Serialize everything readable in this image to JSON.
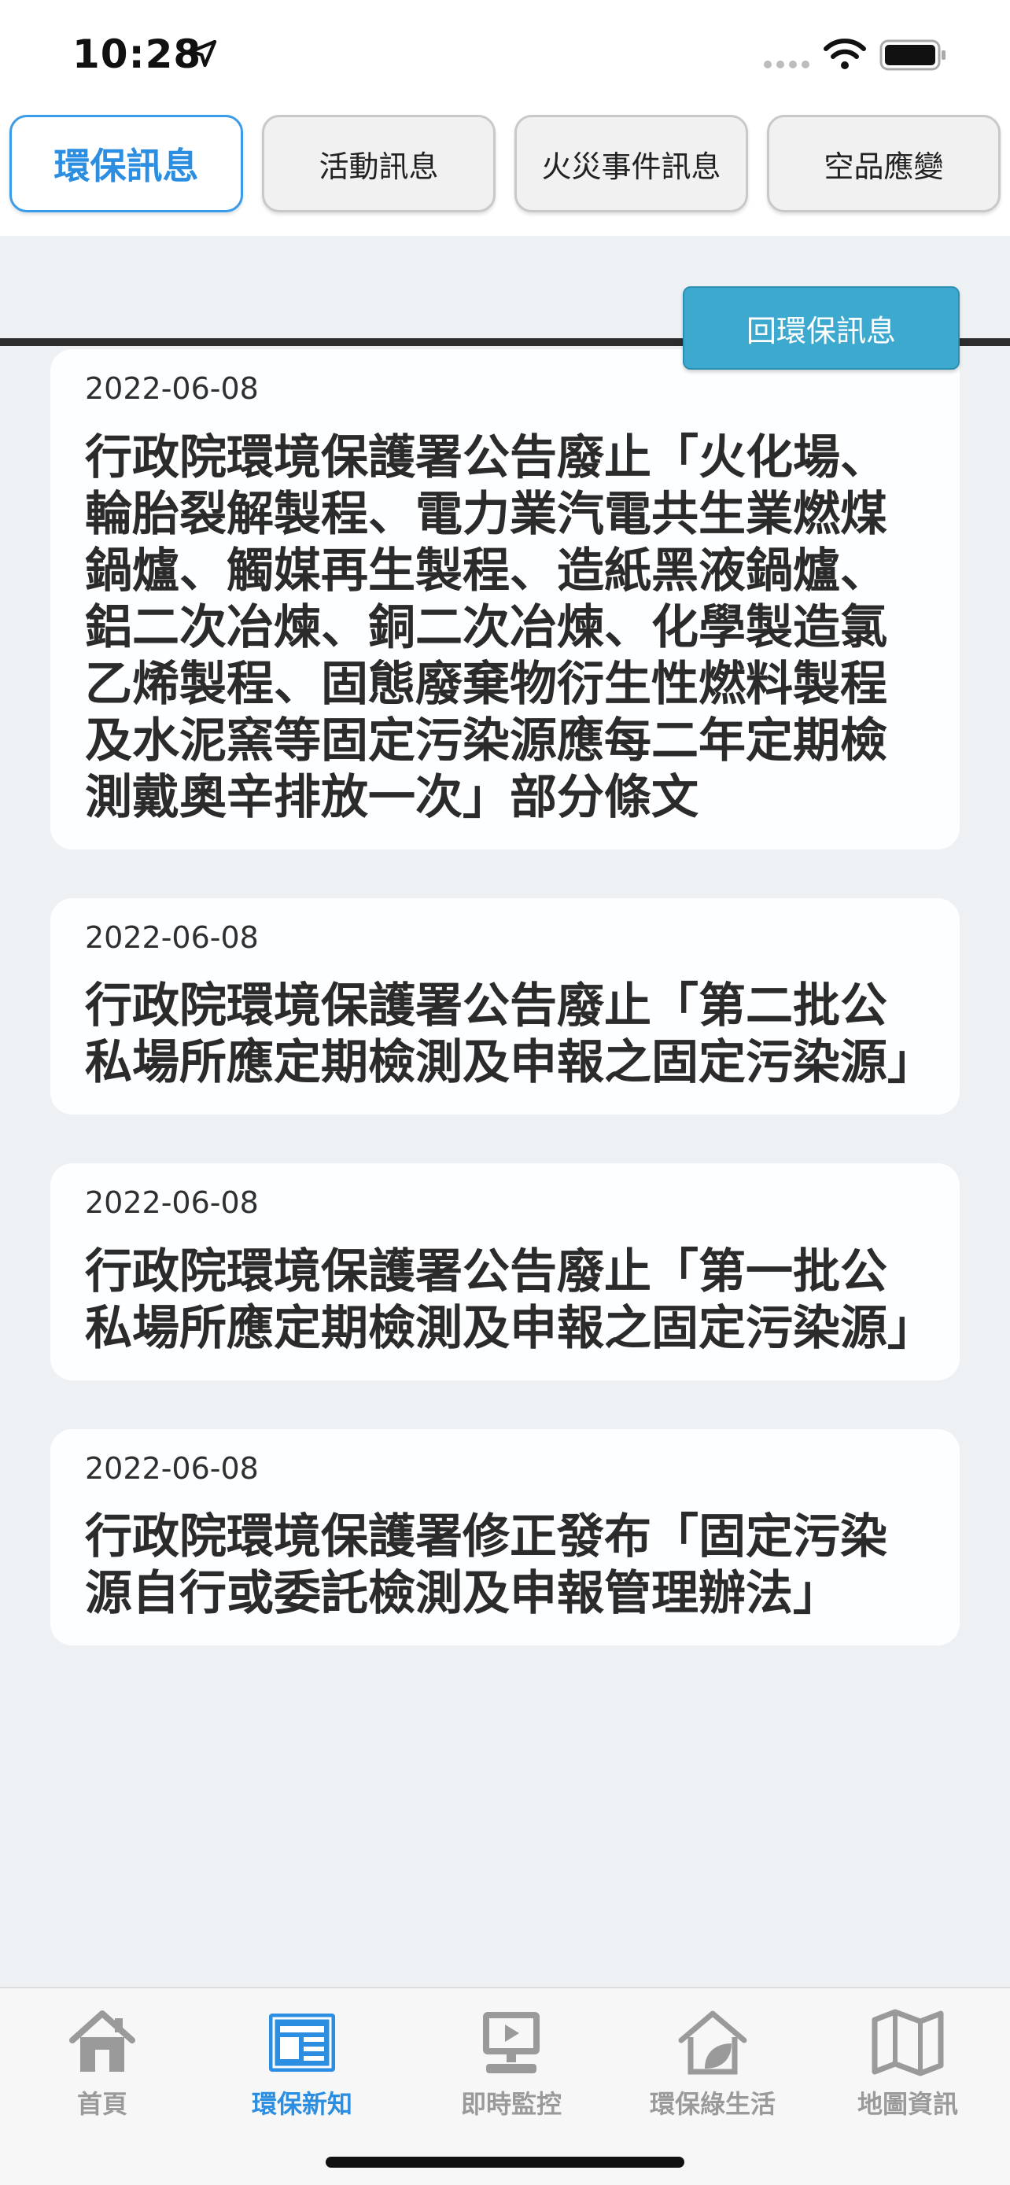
{
  "status_bar": {
    "time": "10:28"
  },
  "tabs": [
    {
      "label": "環保訊息",
      "active": true
    },
    {
      "label": "活動訊息",
      "active": false
    },
    {
      "label": "火災事件訊息",
      "active": false
    },
    {
      "label": "空品應變",
      "active": false
    }
  ],
  "back_button": {
    "label": "回環保訊息"
  },
  "news": [
    {
      "date": "2022-06-08",
      "title": "行政院環境保護署公告廢止「火化場、輪胎裂解製程、電力業汽電共生業燃煤鍋爐、觸媒再生製程、造紙黑液鍋爐、鋁二次冶煉、銅二次冶煉、化學製造氯乙烯製程、固態廢棄物衍生性燃料製程及水泥窯等固定污染源應每二年定期檢測戴奧辛排放一次」部分條文"
    },
    {
      "date": "2022-06-08",
      "title": "行政院環境保護署公告廢止「第二批公私場所應定期檢測及申報之固定污染源」"
    },
    {
      "date": "2022-06-08",
      "title": "行政院環境保護署公告廢止「第一批公私場所應定期檢測及申報之固定污染源」"
    },
    {
      "date": "2022-06-08",
      "title": "行政院環境保護署修正發布「固定污染源自行或委託檢測及申報管理辦法」"
    }
  ],
  "bottom_nav": [
    {
      "label": "首頁",
      "icon": "home-icon"
    },
    {
      "label": "環保新知",
      "icon": "news-icon",
      "active": true
    },
    {
      "label": "即時監控",
      "icon": "monitor-icon"
    },
    {
      "label": "環保綠生活",
      "icon": "green-life-icon"
    },
    {
      "label": "地圖資訊",
      "icon": "map-icon"
    }
  ],
  "colors": {
    "accent": "#2b8ee0",
    "button": "#3ea9cf",
    "background": "#eef1f4"
  }
}
